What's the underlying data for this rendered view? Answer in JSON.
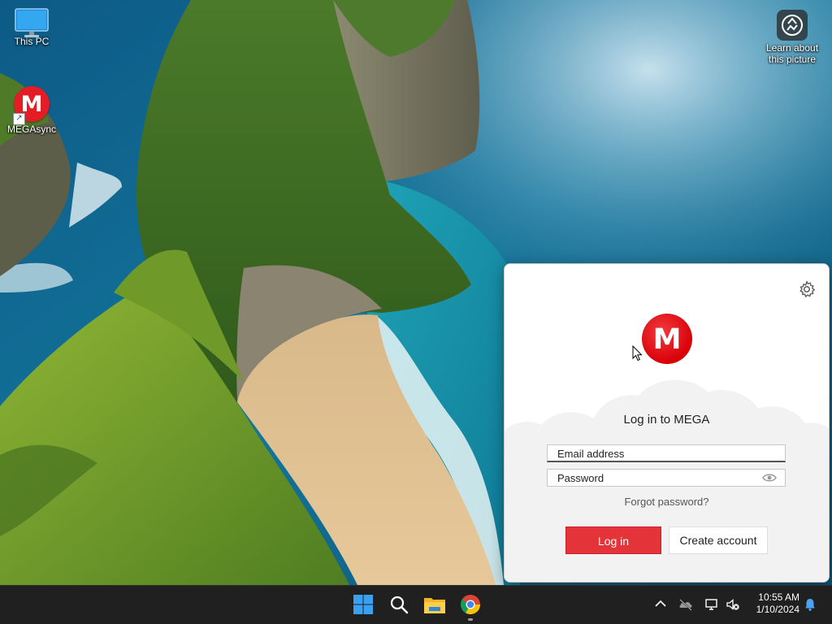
{
  "desktop": {
    "icons": [
      {
        "label": "This PC"
      },
      {
        "label": "MEGAsync",
        "glyph": "M"
      },
      {
        "label": "Learn about this picture"
      }
    ]
  },
  "mega_window": {
    "logo_glyph": "M",
    "title": "Log in to MEGA",
    "email_placeholder": "Email address",
    "password_placeholder": "Password",
    "forgot_label": "Forgot password?",
    "login_label": "Log in",
    "create_label": "Create account",
    "colors": {
      "brand_red": "#e4343a",
      "logo_red": "#d90007"
    }
  },
  "taskbar": {
    "apps": [
      "start-icon",
      "search-icon",
      "file-explorer-icon",
      "chrome-icon"
    ],
    "clock": {
      "time": "10:55 AM",
      "date": "1/10/2024"
    }
  }
}
